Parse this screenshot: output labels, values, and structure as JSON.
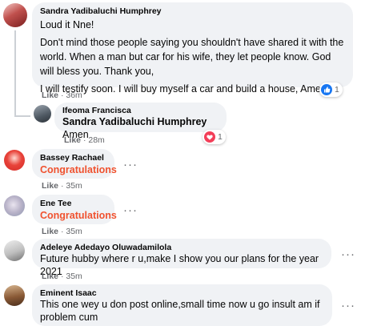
{
  "colors": {
    "bubble": "#f0f2f5",
    "meta": "#65676b",
    "congrats": "#f0522f",
    "like_blue": "#1877f2",
    "love_red": "#f33e58"
  },
  "comments": [
    {
      "author": "Sandra Yadibaluchi Humphrey",
      "paragraphs": [
        "Loud it Nne!",
        "Don't mind those people saying you shouldn't have shared it with the world. When a man but car for his wife, they let people know. God will bless you. Thank you,",
        "I will testify soon. I will buy myself a car and build a house, Amen"
      ],
      "like_label": "Like",
      "time": "36m",
      "reaction": {
        "icon": "like-icon",
        "count": "1"
      }
    },
    {
      "author": "Ifeoma Francisca",
      "mention": "Sandra Yadibaluchi Humphrey",
      "text": " Amen",
      "like_label": "Like",
      "time": "28m",
      "reaction": {
        "icon": "love-icon",
        "count": "1"
      }
    },
    {
      "author": "Bassey Rachael",
      "text": "Congratulations",
      "like_label": "Like",
      "time": "35m"
    },
    {
      "author": "Ene Tee",
      "text": "Congratulations",
      "like_label": "Like",
      "time": "35m"
    },
    {
      "author": "Adeleye Adedayo Oluwadamilola",
      "text": "Future hubby where r u,make I show you our plans for the year 2021",
      "like_label": "Like",
      "time": "35m"
    },
    {
      "author": "Eminent Isaac",
      "text": "This one wey u don post online,small time now u go insult am if problem cum"
    }
  ],
  "separator": "·",
  "more_label": "···"
}
